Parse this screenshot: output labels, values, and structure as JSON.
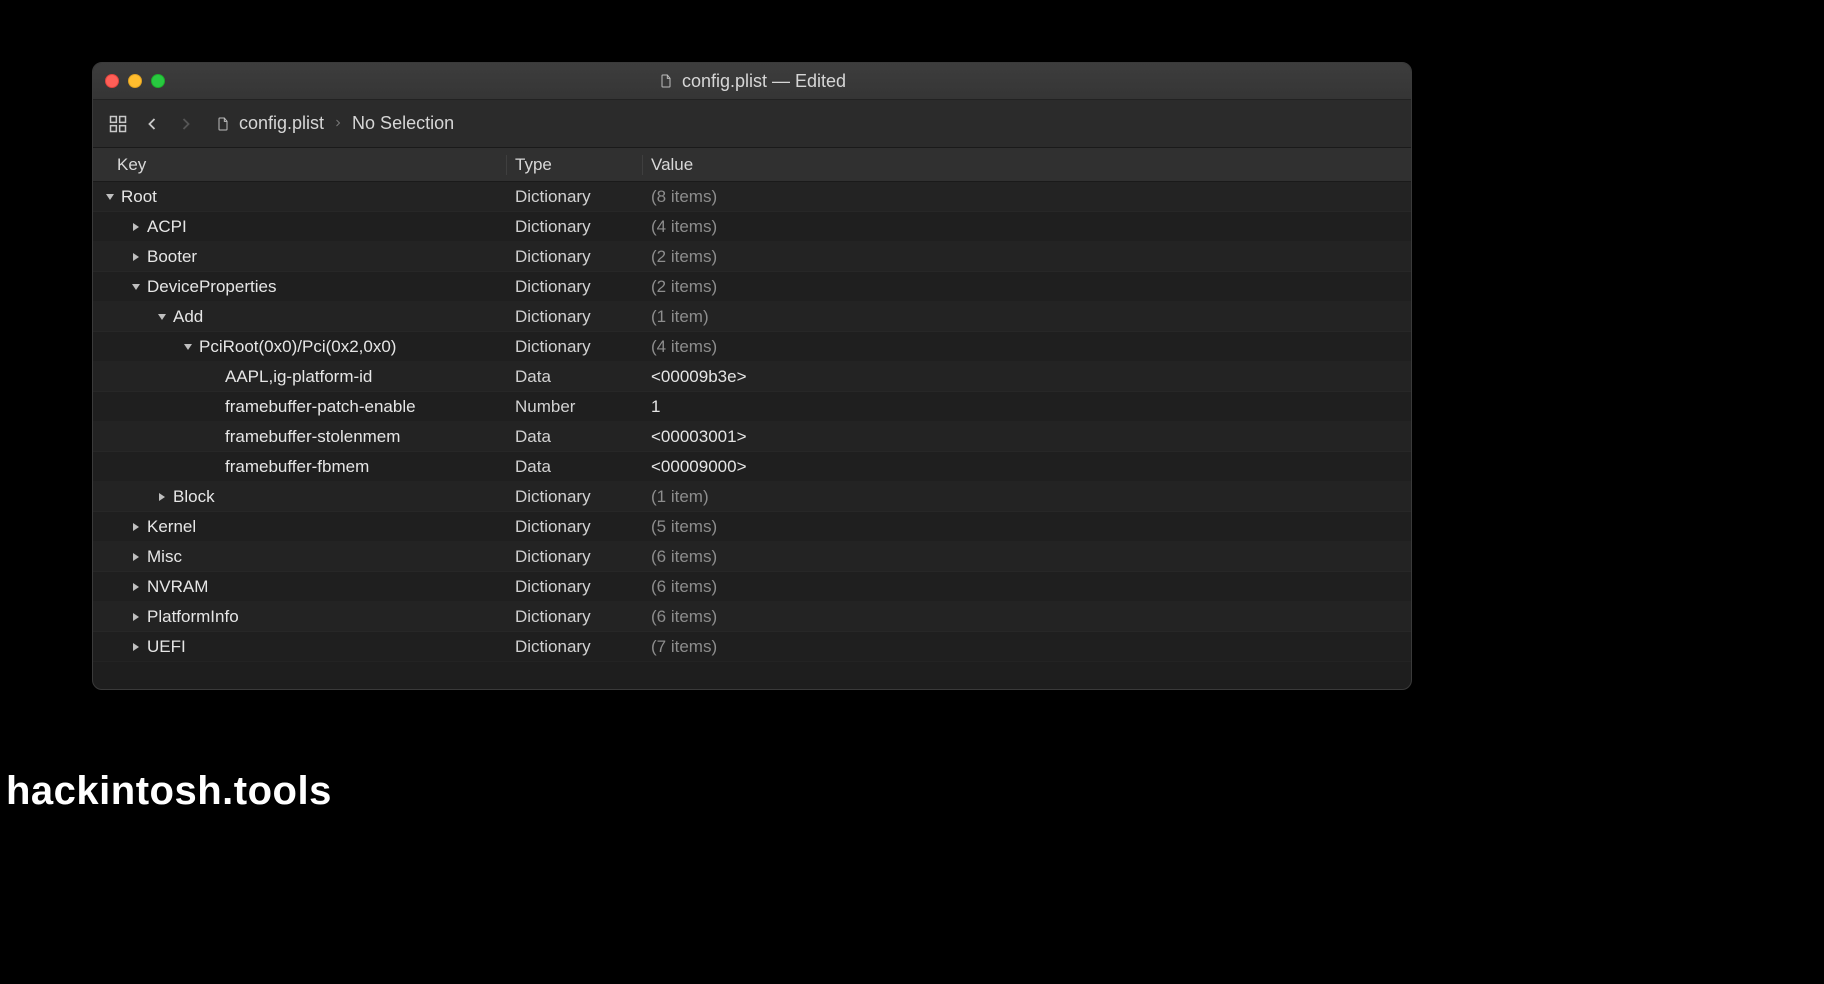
{
  "window": {
    "title": "config.plist — Edited",
    "filename": "config.plist"
  },
  "toolbar": {
    "breadcrumb_file": "config.plist",
    "breadcrumb_sel": "No Selection"
  },
  "columns": {
    "key": "Key",
    "type": "Type",
    "value": "Value"
  },
  "rows": [
    {
      "indent": 0,
      "expanded": true,
      "hasChildren": true,
      "key": "Root",
      "type": "Dictionary",
      "value": "(8 items)",
      "muted": true
    },
    {
      "indent": 1,
      "expanded": false,
      "hasChildren": true,
      "key": "ACPI",
      "type": "Dictionary",
      "value": "(4 items)",
      "muted": true
    },
    {
      "indent": 1,
      "expanded": false,
      "hasChildren": true,
      "key": "Booter",
      "type": "Dictionary",
      "value": "(2 items)",
      "muted": true
    },
    {
      "indent": 1,
      "expanded": true,
      "hasChildren": true,
      "key": "DeviceProperties",
      "type": "Dictionary",
      "value": "(2 items)",
      "muted": true
    },
    {
      "indent": 2,
      "expanded": true,
      "hasChildren": true,
      "key": "Add",
      "type": "Dictionary",
      "value": "(1 item)",
      "muted": true
    },
    {
      "indent": 3,
      "expanded": true,
      "hasChildren": true,
      "key": "PciRoot(0x0)/Pci(0x2,0x0)",
      "type": "Dictionary",
      "value": "(4 items)",
      "muted": true
    },
    {
      "indent": 4,
      "expanded": false,
      "hasChildren": false,
      "key": "AAPL,ig-platform-id",
      "type": "Data",
      "value": "<00009b3e>",
      "muted": false
    },
    {
      "indent": 4,
      "expanded": false,
      "hasChildren": false,
      "key": "framebuffer-patch-enable",
      "type": "Number",
      "value": "1",
      "muted": false
    },
    {
      "indent": 4,
      "expanded": false,
      "hasChildren": false,
      "key": "framebuffer-stolenmem",
      "type": "Data",
      "value": "<00003001>",
      "muted": false
    },
    {
      "indent": 4,
      "expanded": false,
      "hasChildren": false,
      "key": "framebuffer-fbmem",
      "type": "Data",
      "value": "<00009000>",
      "muted": false
    },
    {
      "indent": 2,
      "expanded": false,
      "hasChildren": true,
      "key": "Block",
      "type": "Dictionary",
      "value": "(1 item)",
      "muted": true
    },
    {
      "indent": 1,
      "expanded": false,
      "hasChildren": true,
      "key": "Kernel",
      "type": "Dictionary",
      "value": "(5 items)",
      "muted": true
    },
    {
      "indent": 1,
      "expanded": false,
      "hasChildren": true,
      "key": "Misc",
      "type": "Dictionary",
      "value": "(6 items)",
      "muted": true
    },
    {
      "indent": 1,
      "expanded": false,
      "hasChildren": true,
      "key": "NVRAM",
      "type": "Dictionary",
      "value": "(6 items)",
      "muted": true
    },
    {
      "indent": 1,
      "expanded": false,
      "hasChildren": true,
      "key": "PlatformInfo",
      "type": "Dictionary",
      "value": "(6 items)",
      "muted": true
    },
    {
      "indent": 1,
      "expanded": false,
      "hasChildren": true,
      "key": "UEFI",
      "type": "Dictionary",
      "value": "(7 items)",
      "muted": true
    }
  ],
  "watermark": "hackintosh.tools"
}
